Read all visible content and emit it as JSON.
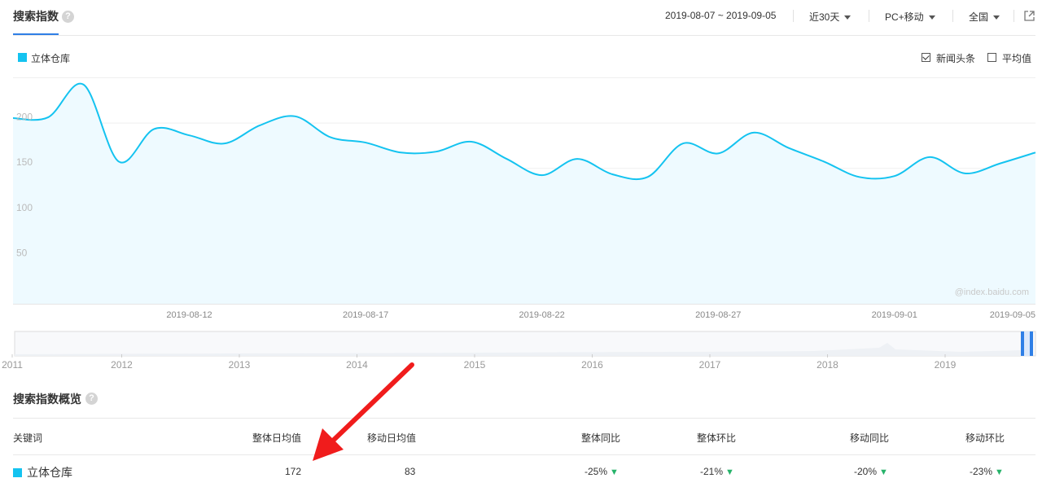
{
  "header": {
    "title": "搜索指数",
    "date_range": "2019-08-07 ~ 2019-09-05",
    "period": "近30天",
    "device": "PC+移动",
    "region": "全国"
  },
  "legend": {
    "series_name": "立体仓库",
    "toggle_news": "新闻头条",
    "toggle_avg": "平均值"
  },
  "colors": {
    "series": "#14c3f0",
    "fill": "#eefaff",
    "accent": "#2f7fe6",
    "arrow": "#f01c1c",
    "down": "#27b36a"
  },
  "chart_data": {
    "type": "line",
    "x_start": "2019-08-07",
    "x_end": "2019-09-05",
    "x_ticks": [
      "2019-08-12",
      "2019-08-17",
      "2019-08-22",
      "2019-08-27",
      "2019-09-01",
      "2019-09-05"
    ],
    "y_ticks": [
      "250",
      "200",
      "150",
      "100",
      "50"
    ],
    "ylim": [
      0,
      250
    ],
    "grid": true,
    "watermark": "@index.baidu.com",
    "series": [
      {
        "name": "立体仓库",
        "dates": [
          "2019-08-07",
          "2019-08-08",
          "2019-08-09",
          "2019-08-10",
          "2019-08-11",
          "2019-08-12",
          "2019-08-13",
          "2019-08-14",
          "2019-08-15",
          "2019-08-16",
          "2019-08-17",
          "2019-08-18",
          "2019-08-19",
          "2019-08-20",
          "2019-08-21",
          "2019-08-22",
          "2019-08-23",
          "2019-08-24",
          "2019-08-25",
          "2019-08-26",
          "2019-08-27",
          "2019-08-28",
          "2019-08-29",
          "2019-08-30",
          "2019-08-31",
          "2019-09-01",
          "2019-09-02",
          "2019-09-03",
          "2019-09-04",
          "2019-09-05"
        ],
        "values": [
          205,
          206,
          242,
          157,
          193,
          186,
          177,
          197,
          207,
          184,
          178,
          167,
          168,
          179,
          160,
          142,
          160,
          143,
          140,
          177,
          166,
          189,
          172,
          157,
          140,
          141,
          162,
          144,
          155,
          167
        ]
      }
    ],
    "overview_years": [
      "2011",
      "2012",
      "2013",
      "2014",
      "2015",
      "2016",
      "2017",
      "2018",
      "2019"
    ]
  },
  "overview": {
    "title": "搜索指数概览",
    "columns": [
      "关键词",
      "整体日均值",
      "移动日均值",
      "整体同比",
      "整体环比",
      "移动同比",
      "移动环比"
    ],
    "row": {
      "keyword": "立体仓库",
      "overall_avg": "172",
      "mobile_avg": "83",
      "overall_yoy": "-25%",
      "overall_qoq": "-21%",
      "mobile_yoy": "-20%",
      "mobile_qoq": "-23%"
    }
  }
}
